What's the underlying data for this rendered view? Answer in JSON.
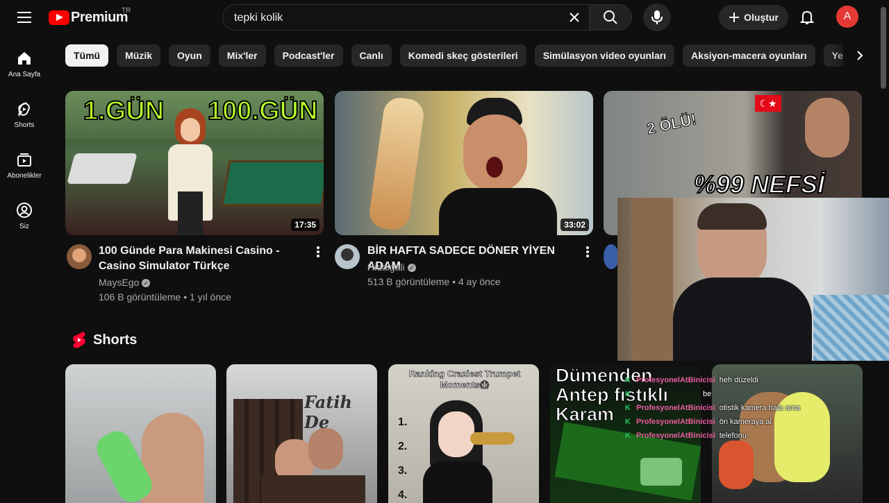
{
  "header": {
    "logo_text": "Premium",
    "country_code": "TR",
    "search_value": "tepki kolik",
    "create_label": "Oluştur",
    "avatar_letter": "A"
  },
  "sidebar": {
    "items": [
      {
        "label": "Ana Sayfa",
        "icon": "home-icon"
      },
      {
        "label": "Shorts",
        "icon": "shorts-icon"
      },
      {
        "label": "Abonelikler",
        "icon": "subscriptions-icon"
      },
      {
        "label": "Siz",
        "icon": "user-icon"
      }
    ]
  },
  "chips": [
    "Tümü",
    "Müzik",
    "Oyun",
    "Mix'ler",
    "Podcast'ler",
    "Canlı",
    "Komedi skeç gösterileri",
    "Simülasyon video oyunları",
    "Aksiyon-macera oyunları",
    "Yemek pişirme"
  ],
  "videos": [
    {
      "title": "100 Günde Para Makinesi Casino - Casino Simulator Türkçe",
      "channel": "MaysEgo",
      "stats": "106 B görüntüleme • 1 yıl önce",
      "duration": "17:35",
      "thumb_text_left": "1.GÜN",
      "thumb_text_right": "100.GÜN"
    },
    {
      "title": "BİR HAFTA SADECE DÖNER YİYEN ADAM",
      "channel": "Hidalgali",
      "stats": "513 B görüntüleme • 4 ay önce",
      "duration": "33:02"
    },
    {
      "thumb_text_top": "2 ÖLÜ!",
      "thumb_text_bottom": "%99 NEFSİ"
    }
  ],
  "shorts": {
    "heading": "Shorts",
    "items": [
      {
        "overlay": ""
      },
      {
        "overlay": "Fatih De"
      },
      {
        "overlay": "Ranking Craziest Trumpet Moments😱"
      },
      {
        "overlay": "Dümenden Antep fıstıklı Karam"
      },
      {
        "overlay": ""
      }
    ]
  },
  "chat": {
    "lines": [
      {
        "user": "ProfesyonelAtBinicisi",
        "msg": "heh düzeldi"
      },
      {
        "user": "",
        "msg": "be"
      },
      {
        "user": "ProfesyonelAtBinicisi",
        "msg": "otistik kamera hala ama"
      },
      {
        "user": "ProfesyonelAtBinicisi",
        "msg": "ön kameraya al"
      },
      {
        "user": "ProfesyonelAtBinicisi",
        "msg": "telefonu"
      }
    ]
  },
  "colors": {
    "background": "#0f0f0f",
    "accent_red": "#ff0000",
    "chip_active": "#f1f1f1",
    "chip_bg": "#272727",
    "secondary_text": "#aaaaaa"
  }
}
